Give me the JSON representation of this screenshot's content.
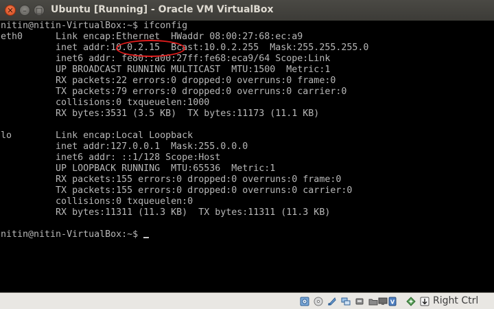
{
  "window": {
    "title": "Ubuntu [Running] - Oracle VM VirtualBox",
    "close_glyph": "✕",
    "minimize_glyph": "–",
    "maximize_glyph": "□"
  },
  "terminal": {
    "lines": [
      "nitin@nitin-VirtualBox:~$ ifconfig",
      "eth0      Link encap:Ethernet  HWaddr 08:00:27:68:ec:a9",
      "          inet addr:10.0.2.15  Bcast:10.0.2.255  Mask:255.255.255.0",
      "          inet6 addr: fe80::a00:27ff:fe68:eca9/64 Scope:Link",
      "          UP BROADCAST RUNNING MULTICAST  MTU:1500  Metric:1",
      "          RX packets:22 errors:0 dropped:0 overruns:0 frame:0",
      "          TX packets:79 errors:0 dropped:0 overruns:0 carrier:0",
      "          collisions:0 txqueuelen:1000",
      "          RX bytes:3531 (3.5 KB)  TX bytes:11173 (11.1 KB)",
      "",
      "lo        Link encap:Local Loopback",
      "          inet addr:127.0.0.1  Mask:255.0.0.0",
      "          inet6 addr: ::1/128 Scope:Host",
      "          UP LOOPBACK RUNNING  MTU:65536  Metric:1",
      "          RX packets:155 errors:0 dropped:0 overruns:0 frame:0",
      "          TX packets:155 errors:0 dropped:0 overruns:0 carrier:0",
      "          collisions:0 txqueuelen:0",
      "          RX bytes:11311 (11.3 KB)  TX bytes:11311 (11.3 KB)",
      "",
      "nitin@nitin-VirtualBox:~$ "
    ],
    "highlight_annotation": "10.0.2.15"
  },
  "statusbar": {
    "icons": [
      "hard-disk-icon",
      "optical-drive-icon",
      "audio-icon",
      "network-icon",
      "usb-icon",
      "shared-folders-icon",
      "display-icon",
      "video-capture-icon",
      "mouse-integration-icon",
      "host-key-arrow-icon"
    ],
    "host_key_label": "Right Ctrl"
  }
}
